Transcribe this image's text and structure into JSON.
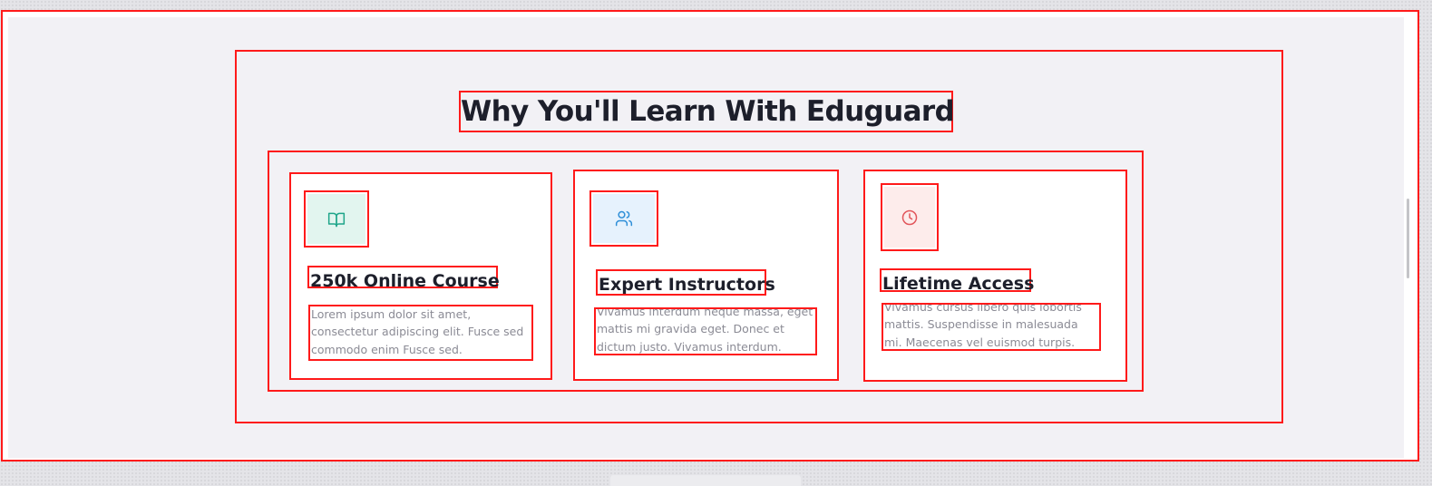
{
  "section": {
    "title": "Why You'll Learn With Eduguard"
  },
  "features": [
    {
      "icon": "book-open-icon",
      "icon_color": "#1fa58a",
      "icon_bg": "#e2f5ef",
      "title": "250k Online Course",
      "text": "Lorem ipsum dolor sit amet, consectetur adipiscing elit. Fusce sed commodo enim Fusce sed."
    },
    {
      "icon": "users-icon",
      "icon_color": "#2f8fd8",
      "icon_bg": "#e6f2fd",
      "title": "Expert Instructors",
      "text": "Vivamus interdum neque massa, eget mattis mi gravida eget. Donec et dictum justo. Vivamus interdum."
    },
    {
      "icon": "clock-icon",
      "icon_color": "#e2565b",
      "icon_bg": "#fdeceb",
      "title": "Lifetime Access",
      "text": "Vivamus cursus libero quis lobortis mattis. Suspendisse in malesuada mi. Maecenas vel euismod turpis."
    }
  ],
  "colors": {
    "annotation_border": "#ff1a1a",
    "page_background": "#f2f1f5",
    "heading": "#1d1f2b",
    "body_text": "#8b8b95"
  }
}
